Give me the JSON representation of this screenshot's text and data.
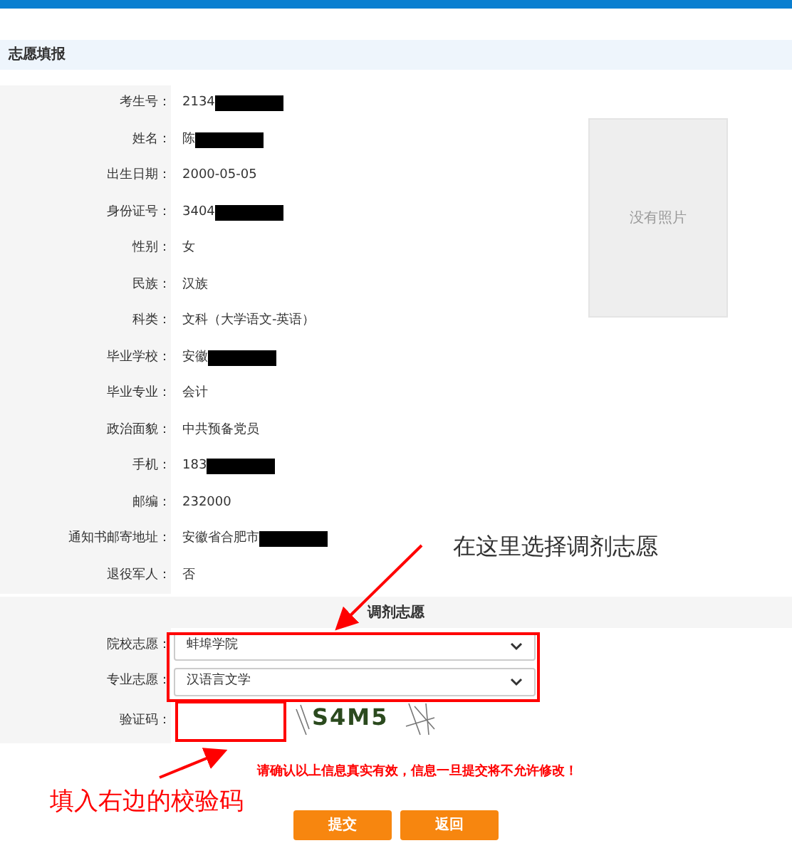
{
  "section_title": "志愿填报",
  "fields": [
    {
      "label": "考生号：",
      "value": "2134",
      "redacted": true
    },
    {
      "label": "姓名：",
      "value": "陈",
      "redacted": true
    },
    {
      "label": "出生日期：",
      "value": "2000-05-05",
      "redacted": false
    },
    {
      "label": "身份证号：",
      "value": "3404",
      "redacted": true
    },
    {
      "label": "性别：",
      "value": "女",
      "redacted": false
    },
    {
      "label": "民族：",
      "value": "汉族",
      "redacted": false
    },
    {
      "label": "科类：",
      "value": "文科（大学语文-英语）",
      "redacted": false
    },
    {
      "label": "毕业学校：",
      "value": "安徽",
      "redacted": true
    },
    {
      "label": "毕业专业：",
      "value": "会计",
      "redacted": false
    },
    {
      "label": "政治面貌：",
      "value": "中共预备党员",
      "redacted": false
    },
    {
      "label": "手机：",
      "value": "183",
      "redacted": true
    },
    {
      "label": "邮编：",
      "value": "232000",
      "redacted": false
    },
    {
      "label": "通知书邮寄地址：",
      "value": "安徽省合肥市",
      "redacted": true
    },
    {
      "label": "退役军人：",
      "value": "否",
      "redacted": false
    }
  ],
  "photo": {
    "text": "没有照片"
  },
  "adjust_section": {
    "title": "调剂志愿",
    "selects": [
      {
        "label": "院校志愿：",
        "value": "蚌埠学院"
      },
      {
        "label": "专业志愿：",
        "value": "汉语言文学"
      }
    ],
    "captcha": {
      "label": "验证码：",
      "code": "S4M5"
    }
  },
  "warning": "请确认以上信息真实有效，信息一旦提交将不允许修改！",
  "buttons": [
    "提交",
    "返回"
  ],
  "annotations": [
    {
      "text": "在这里选择调剂志愿"
    },
    {
      "text": "填入右边的校验码"
    }
  ]
}
